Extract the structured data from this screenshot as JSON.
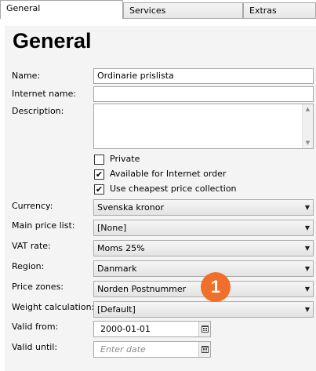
{
  "tabs": [
    {
      "label": "General",
      "active": true
    },
    {
      "label": "Services",
      "active": false
    },
    {
      "label": "Extras",
      "active": false
    }
  ],
  "form": {
    "title": "General",
    "name": {
      "label": "Name:",
      "value": "Ordinarie prislista"
    },
    "internet_name": {
      "label": "Internet name:",
      "value": ""
    },
    "description": {
      "label": "Description:",
      "value": ""
    },
    "checkboxes": [
      {
        "label": "Private",
        "checked": false
      },
      {
        "label": "Available for Internet order",
        "checked": true
      },
      {
        "label": "Use cheapest price collection",
        "checked": true
      }
    ],
    "currency": {
      "label": "Currency:",
      "value": "Svenska kronor"
    },
    "main_price_list": {
      "label": "Main price list:",
      "value": "[None]"
    },
    "vat_rate": {
      "label": "VAT rate:",
      "value": "Moms 25%"
    },
    "region": {
      "label": "Region:",
      "value": "Danmark"
    },
    "price_zones": {
      "label": "Price zones:",
      "value": "Norden Postnummer"
    },
    "weight_calculation": {
      "label": "Weight calculation:",
      "value": "[Default]"
    },
    "valid_from": {
      "label": "Valid from:",
      "value": "2000-01-01"
    },
    "valid_until": {
      "label": "Valid until:",
      "placeholder": "Enter date"
    }
  },
  "callout": {
    "number": "1",
    "color": "#f06f2a"
  },
  "icons": {
    "checkmark": "✔",
    "dropdown": "chevron-down-icon",
    "calendar": "calendar-icon",
    "scroll_up": "▲",
    "scroll_down": "▼"
  }
}
